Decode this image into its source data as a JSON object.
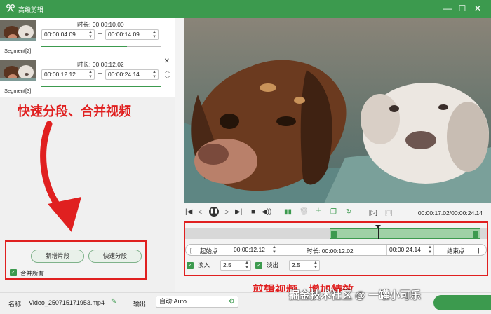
{
  "window": {
    "title": "高级剪辑",
    "minimize": "—",
    "maximize": "☐",
    "close": "✕"
  },
  "segments": [
    {
      "label": "Segment[2]",
      "duration_label": "时长:",
      "duration": "00:00:10.00",
      "start": "00:00:04.09",
      "end": "00:00:14.09",
      "progress_fraction": 0.72
    },
    {
      "label": "Segment[3]",
      "duration_label": "时长:",
      "duration": "00:00:12.02",
      "start": "00:00:12.12",
      "end": "00:00:24.14",
      "progress_fraction": 1.0
    }
  ],
  "annotations": {
    "left_caption": "快速分段、合并视频",
    "right_caption": "剪辑视频、增加特效",
    "watermark": "掘金技术社区 @ 一罐小可乐"
  },
  "left_buttons": {
    "new_segment": "新增片段",
    "quick_split": "快速分段",
    "merge_all": "合并所有"
  },
  "player": {
    "timecode": "00:00:17.02/00:00:24.14",
    "playhead_fraction": 0.64
  },
  "trim": {
    "start_btn": "起始点",
    "start_value": "00:00:12.12",
    "duration_label": "时长:",
    "duration_value": "00:00:12.02",
    "end_value": "00:00:24.14",
    "end_btn": "结束点"
  },
  "effects": {
    "fade_in_label": "淡入",
    "fade_in_value": "2.5",
    "fade_out_label": "淡出",
    "fade_out_value": "2.5"
  },
  "status": {
    "name_label": "名称:",
    "file_name": "Video_250715171953.mp4",
    "output_label": "输出:",
    "output_value": "自动:Auto"
  },
  "colors": {
    "accent": "#3c9a4e",
    "highlight": "#e02020"
  }
}
